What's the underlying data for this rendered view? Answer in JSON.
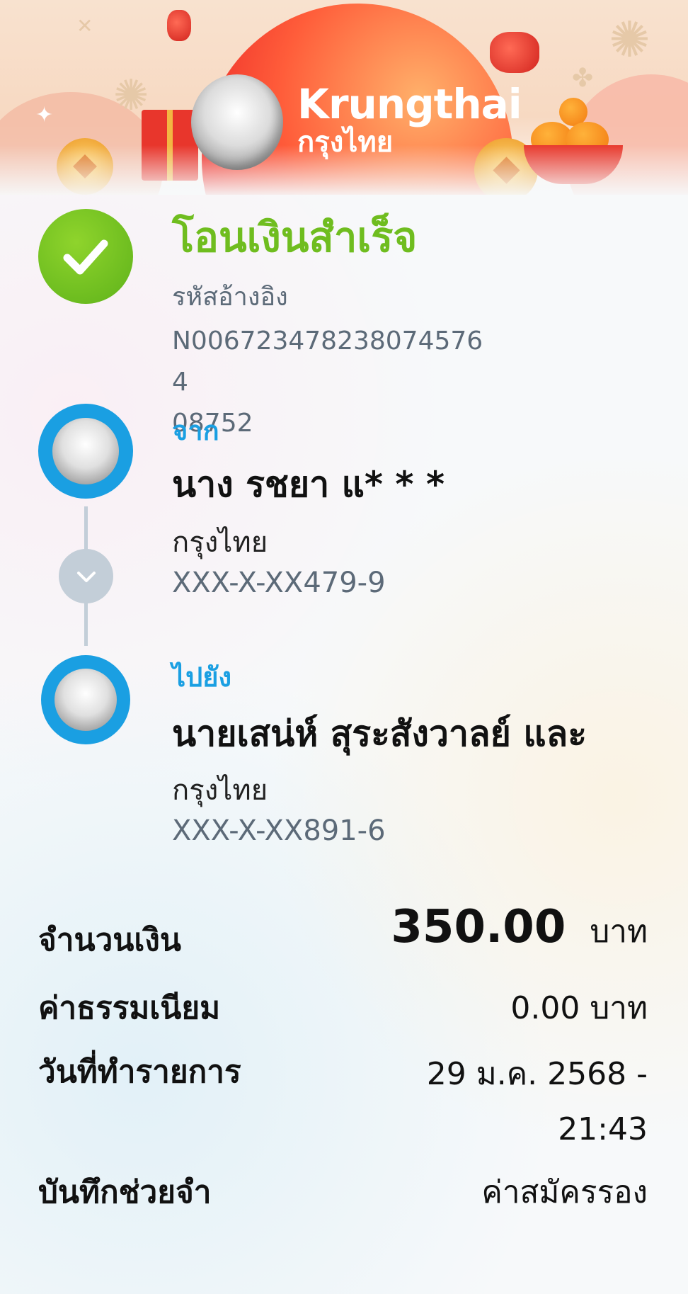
{
  "banner": {
    "brand_en": "Krungthai",
    "brand_th": "กรุงไทย"
  },
  "status": {
    "title": "โอนเงินสำเร็จ",
    "ref_label": "รหัสอ้างอิง",
    "ref_value": "N00672347823807457640875 2",
    "ref_line1": "N006723478238074576 4",
    "ref_lines": [
      "N0067234782380745764",
      "08752"
    ]
  },
  "from": {
    "label": "จาก",
    "name": "นาง รชยา แ* * *",
    "bank": "กรุงไทย",
    "account": "XXX-X-XX479-9"
  },
  "to": {
    "label": "ไปยัง",
    "name": "นายเสน่ห์ สุระสังวาลย์ และ",
    "bank": "กรุงไทย",
    "account": "XXX-X-XX891-6"
  },
  "details": {
    "amount_label": "จำนวนเงิน",
    "amount_value": "350.00",
    "amount_unit": "บาท",
    "fee_label": "ค่าธรรมเนียม",
    "fee_value": "0.00 บาท",
    "date_label": "วันที่ทำรายการ",
    "date_value_line1": "29 ม.ค. 2568 -",
    "date_value_line2": "21:43",
    "memo_label": "บันทึกช่วยจำ",
    "memo_value": "ค่าสมัครรอง"
  },
  "colors": {
    "success_green": "#6fbd1f",
    "brand_blue": "#1a9fe2",
    "muted_text": "#5c6a78"
  }
}
